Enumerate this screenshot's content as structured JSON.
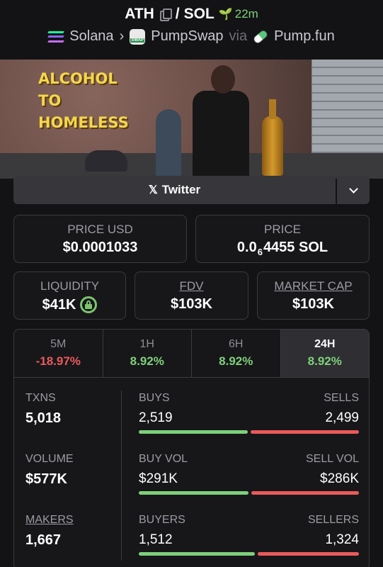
{
  "header": {
    "base": "ATH",
    "separator": "/",
    "quote": "SOL",
    "age": "22m",
    "chain": "Solana",
    "dex": "PumpSwap",
    "via": "via",
    "launchpad": "Pump.fun"
  },
  "banner": {
    "overlay_line1": "ALCOHOL",
    "overlay_line2": "TO",
    "overlay_line3": "HOMELESS"
  },
  "social": {
    "twitter_label": "Twitter",
    "icon": "x-icon"
  },
  "prices": {
    "price_usd_label": "PRICE USD",
    "price_usd_value": "$0.0001033",
    "price_label": "PRICE",
    "price_prefix": "0.0",
    "price_subscript": "6",
    "price_suffix": "4455 SOL"
  },
  "metrics": {
    "liquidity_label": "LIQUIDITY",
    "liquidity_value": "$41K",
    "fdv_label": "FDV",
    "fdv_value": "$103K",
    "mcap_label": "MARKET CAP",
    "mcap_value": "$103K"
  },
  "timeframes": [
    {
      "label": "5M",
      "change": "-18.97%",
      "dir": "neg"
    },
    {
      "label": "1H",
      "change": "8.92%",
      "dir": "pos"
    },
    {
      "label": "6H",
      "change": "8.92%",
      "dir": "pos"
    },
    {
      "label": "24H",
      "change": "8.92%",
      "dir": "pos",
      "active": true
    }
  ],
  "stats": {
    "txns_label": "TXNS",
    "txns_value": "5,018",
    "buys_label": "BUYS",
    "buys_value": "2,519",
    "sells_label": "SELLS",
    "sells_value": "2,499",
    "volume_label": "VOLUME",
    "volume_value": "$577K",
    "buy_vol_label": "BUY VOL",
    "buy_vol_value": "$291K",
    "sell_vol_label": "SELL VOL",
    "sell_vol_value": "$286K",
    "makers_label": "MAKERS",
    "makers_value": "1,667",
    "buyers_label": "BUYERS",
    "buyers_value": "1,512",
    "sellers_label": "SELLERS",
    "sellers_value": "1,324"
  },
  "bar_fractions": {
    "txns_buy": 0.502,
    "volume_buy": 0.504,
    "makers_buy": 0.533
  },
  "colors": {
    "positive": "#7ed07a",
    "negative": "#ea5a5a",
    "background": "#131316"
  }
}
